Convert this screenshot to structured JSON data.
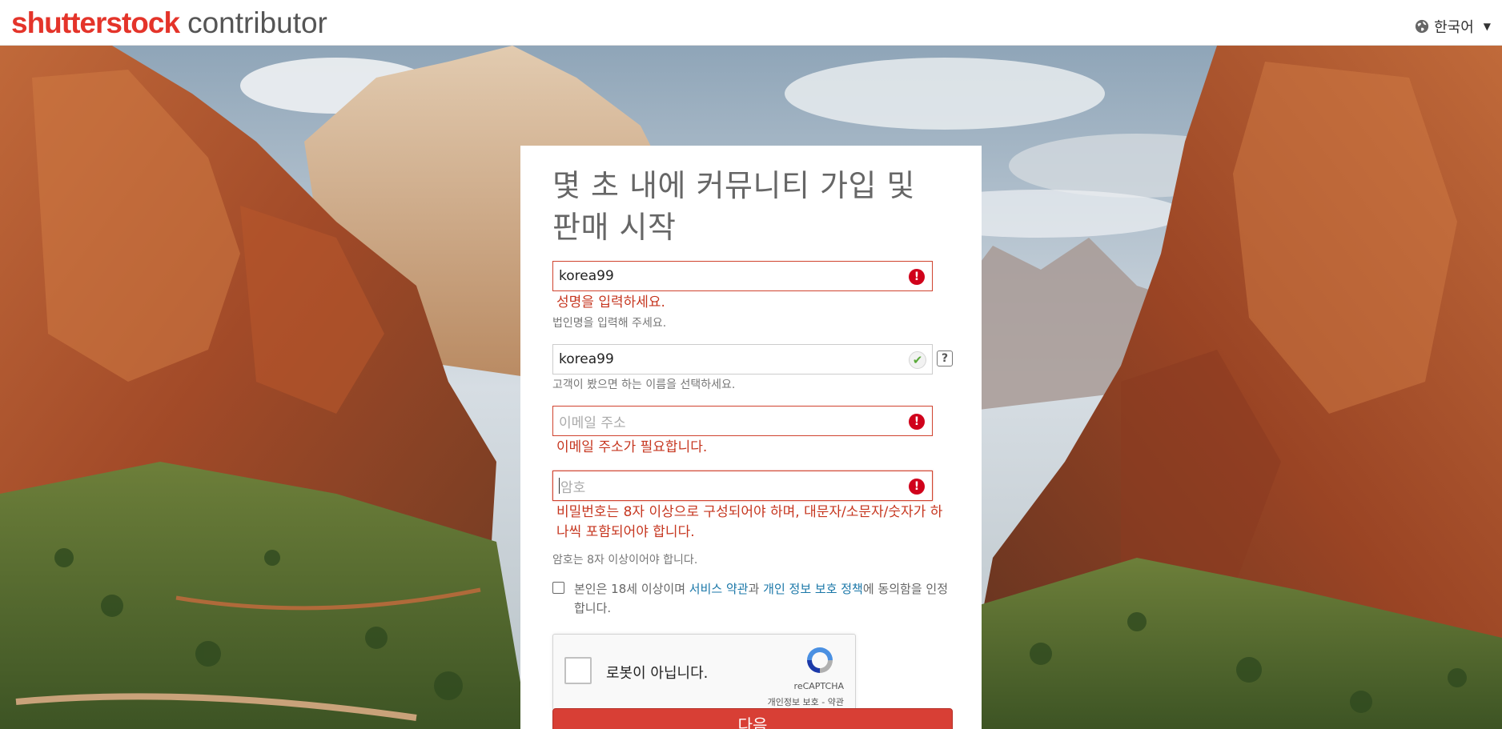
{
  "header": {
    "logo_brand": "shutterstock",
    "logo_sub": "contributor",
    "language": "한국어"
  },
  "form": {
    "title": "몇 초 내에 커뮤니티 가입 및 판매 시작",
    "name_field": {
      "value": "korea99",
      "error": "성명을 입력하세요.",
      "hint": "법인명을 입력해 주세요."
    },
    "display_name_field": {
      "value": "korea99",
      "hint": "고객이 봤으면 하는 이름을 선택하세요."
    },
    "email_field": {
      "placeholder": "이메일 주소",
      "error": "이메일 주소가 필요합니다."
    },
    "password_field": {
      "placeholder": "암호",
      "error": "비밀번호는 8자 이상으로 구성되어야 하며, 대문자/소문자/숫자가 하나씩 포함되어야 합니다.",
      "hint": "암호는 8자 이상이어야 합니다."
    },
    "terms": {
      "prefix": "본인은 18세 이상이며 ",
      "link_terms": "서비스 약관",
      "middle": "과 ",
      "link_privacy": "개인 정보 보호 정책",
      "suffix": "에 동의함을 인정합니다."
    },
    "recaptcha": {
      "label": "로봇이 아닙니다.",
      "brand": "reCAPTCHA",
      "links": "개인정보 보호 - 약관"
    },
    "next_button": "다음"
  },
  "colors": {
    "brand_red": "#e4342a",
    "error_red": "#c6361f",
    "link_blue": "#1a77a8",
    "button_red": "#d83f35"
  }
}
